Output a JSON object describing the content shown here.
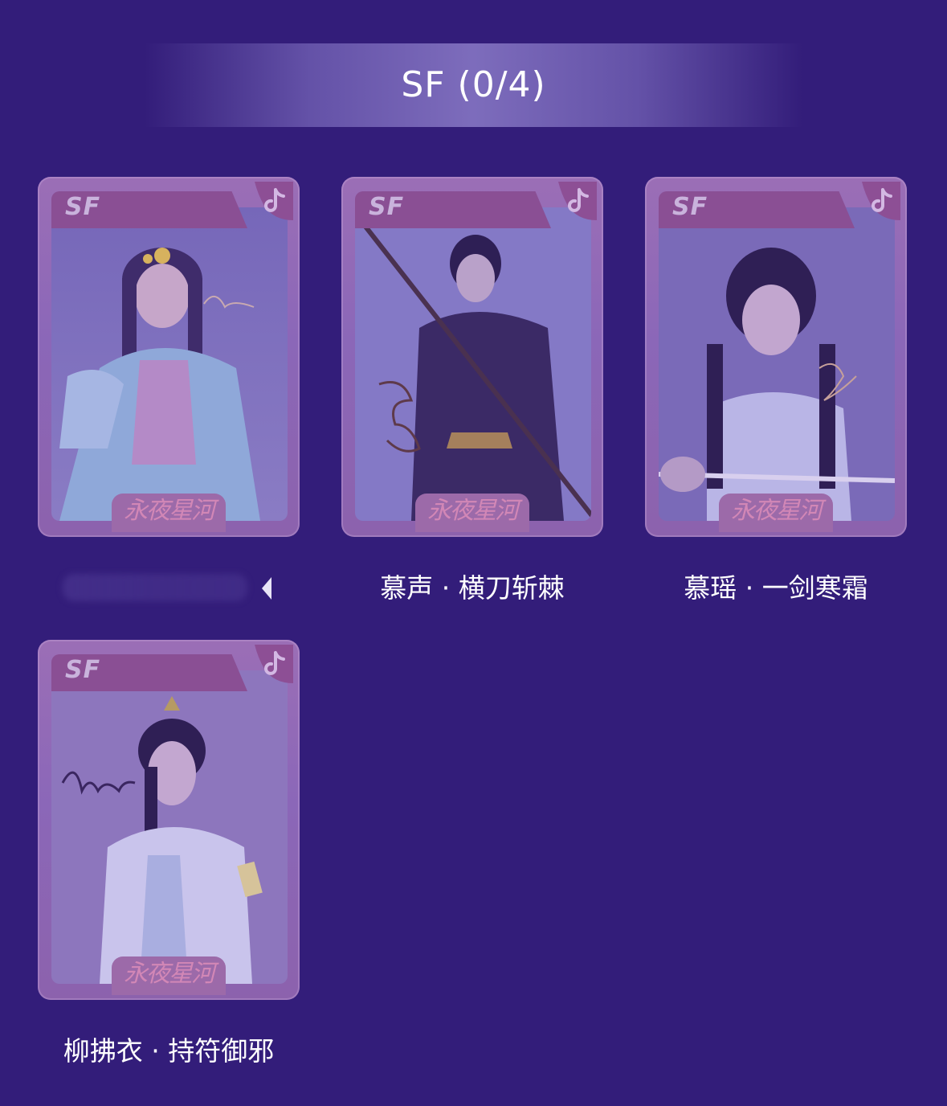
{
  "header": {
    "title": "SF (0/4)"
  },
  "cards": [
    {
      "rarity": "SF",
      "name": "",
      "logo": "永夜星河",
      "signature_color": "#c8a9b0",
      "photo_bg": "#7d6cbd",
      "icon": "douyin-note-icon"
    },
    {
      "rarity": "SF",
      "name": "慕声 · 横刀斩棘",
      "logo": "永夜星河",
      "signature_color": "#5e3a4a",
      "photo_bg": "#8479c6",
      "icon": "douyin-note-icon"
    },
    {
      "rarity": "SF",
      "name": "慕瑶 · 一剑寒霜",
      "logo": "永夜星河",
      "signature_color": "#c6a09a",
      "photo_bg": "#7a6ab8",
      "icon": "douyin-note-icon"
    },
    {
      "rarity": "SF",
      "name": "柳拂衣 · 持符御邪",
      "logo": "永夜星河",
      "signature_color": "#3a2660",
      "photo_bg": "#8d76bd",
      "icon": "douyin-note-icon"
    }
  ],
  "colors": {
    "background": "#331d7a",
    "card_frame": "#9b6eb6",
    "text": "#ffffff"
  }
}
